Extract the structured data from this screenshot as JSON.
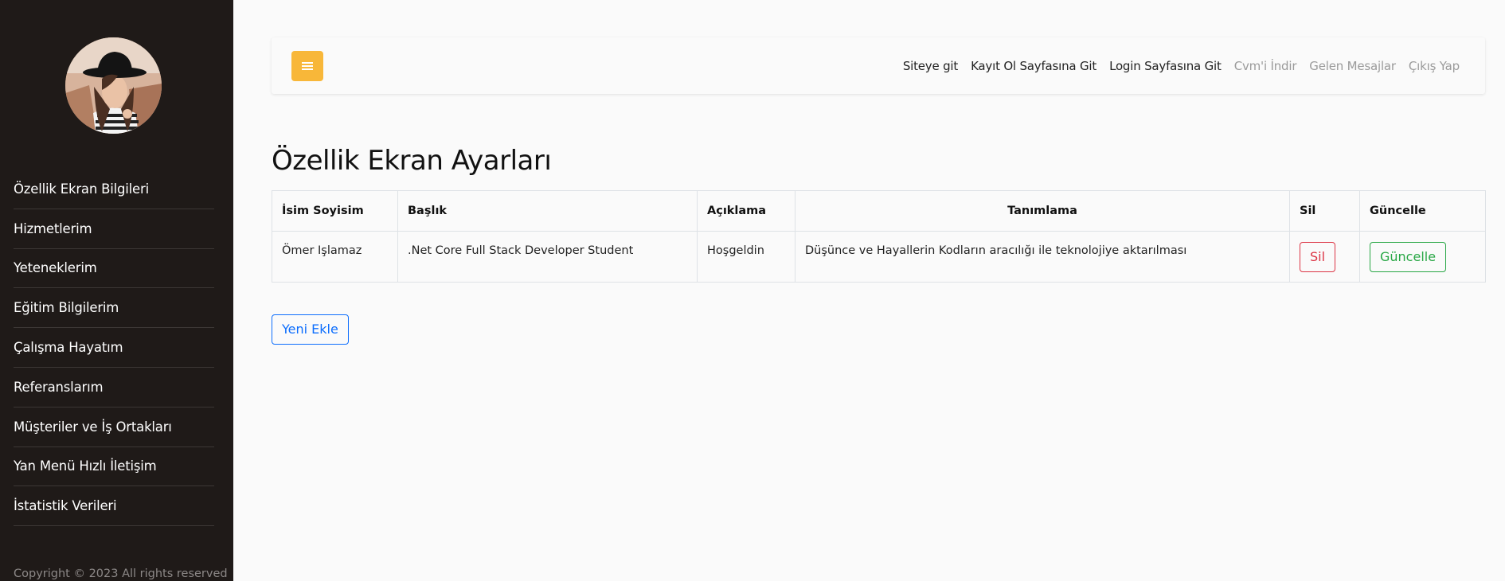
{
  "sidebar": {
    "avatar_alt": "profile photo",
    "items": [
      {
        "label": "Özellik Ekran Bilgileri"
      },
      {
        "label": "Hizmetlerim"
      },
      {
        "label": "Yeteneklerim"
      },
      {
        "label": "Eğitim Bilgilerim"
      },
      {
        "label": "Çalışma Hayatım"
      },
      {
        "label": "Referanslarım"
      },
      {
        "label": "Müşteriler ve İş Ortakları"
      },
      {
        "label": "Yan Menü Hızlı İletişim"
      },
      {
        "label": "İstatistik Verileri"
      }
    ],
    "copyright": "Copyright © 2023 All rights reserved"
  },
  "topbar": {
    "toggle_icon": "hamburger-menu-icon",
    "links": [
      {
        "label": "Siteye git"
      },
      {
        "label": "Kayıt Ol Sayfasına Git"
      },
      {
        "label": "Login Sayfasına Git"
      },
      {
        "label": "Cvm'i İndir"
      },
      {
        "label": "Gelen Mesajlar"
      },
      {
        "label": "Çıkış Yap"
      }
    ]
  },
  "main": {
    "title": "Özellik Ekran Ayarları",
    "table": {
      "headers": [
        "İsim Soyisim",
        "Başlık",
        "Açıklama",
        "Tanımlama",
        "Sil",
        "Güncelle"
      ],
      "rows": [
        {
          "name": "Ömer Işlamaz",
          "title": ".Net Core Full Stack Developer Student",
          "description": "Hoşgeldin",
          "definition": "Düşünce ve Hayallerin Kodların aracılığı ile teknolojiye aktarılması",
          "delete_label": "Sil",
          "update_label": "Güncelle"
        }
      ]
    },
    "add_button": "Yeni Ekle"
  },
  "colors": {
    "sidebar_bg": "#1f1a18",
    "toggle_bg": "#f8b739",
    "danger": "#dc3545",
    "success": "#28a745",
    "primary": "#0d6efd"
  }
}
